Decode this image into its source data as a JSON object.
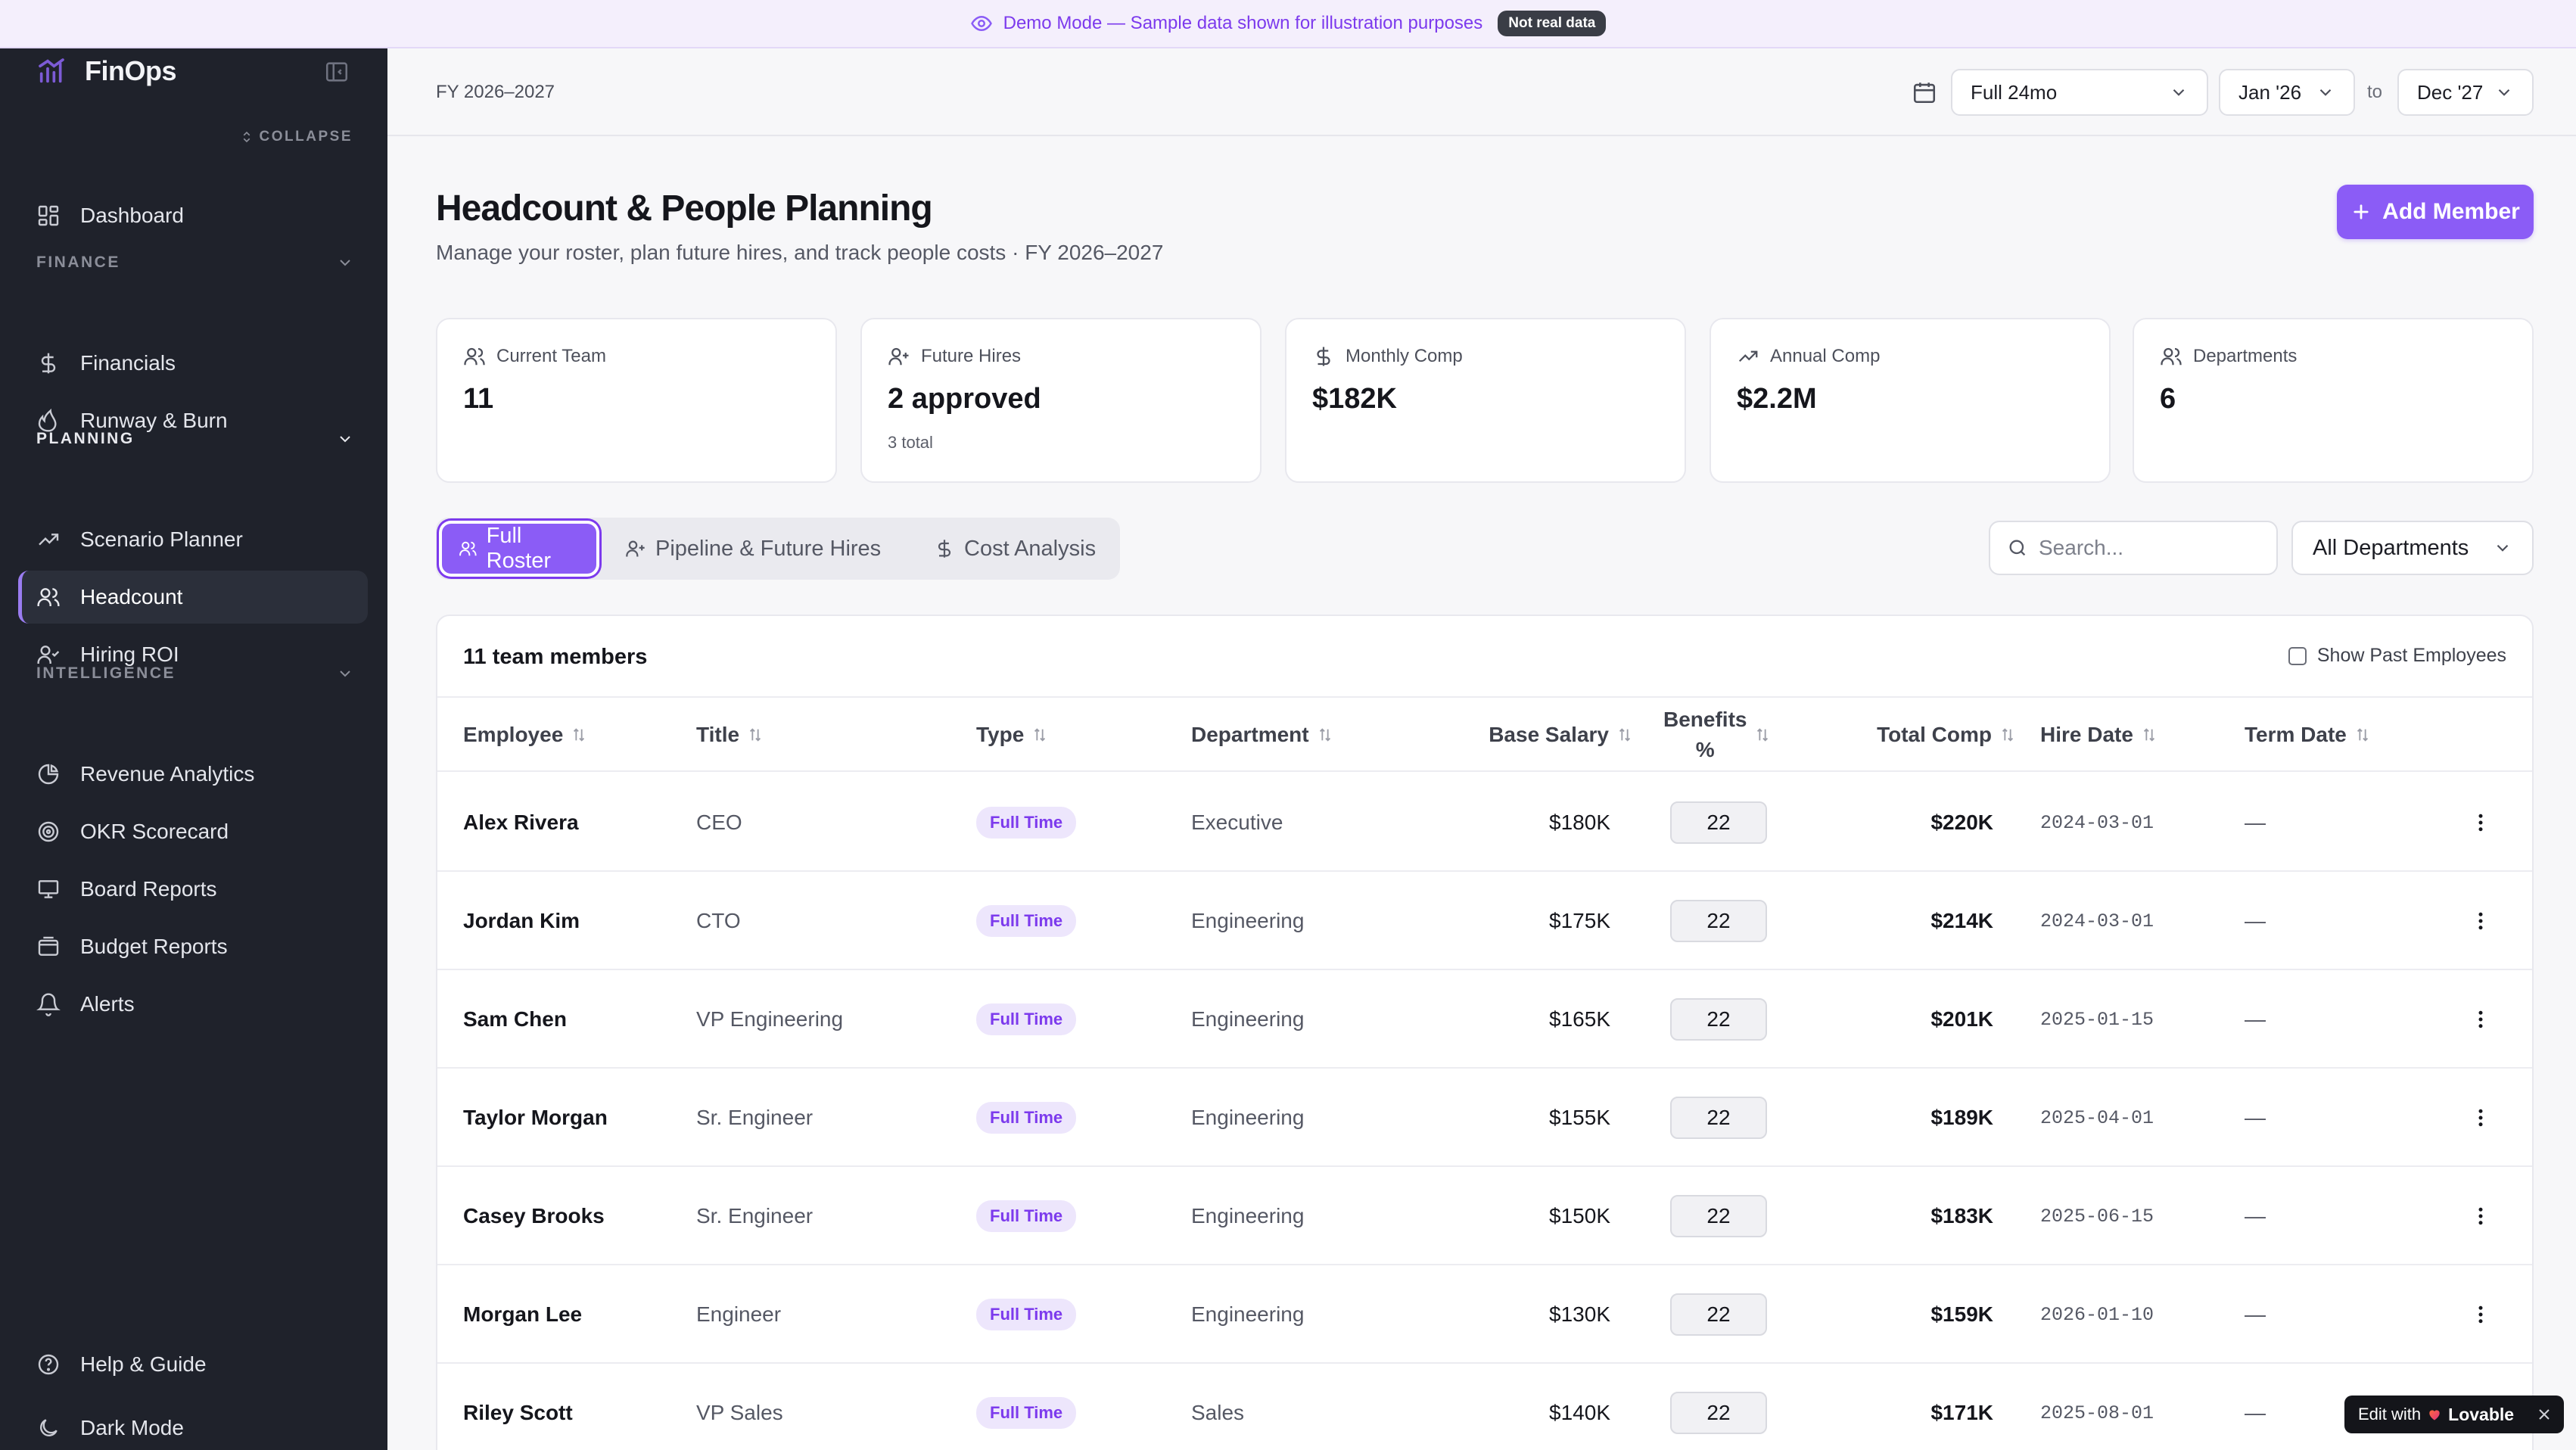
{
  "banner": {
    "text": "Demo Mode — Sample data shown for illustration purposes",
    "badge": "Not real data"
  },
  "sidebar": {
    "brand": "FinOps",
    "collapse_label": "COLLAPSE",
    "dashboard": "Dashboard",
    "sections": {
      "finance": "FINANCE",
      "planning": "PLANNING",
      "intelligence": "INTELLIGENCE"
    },
    "finance_items": [
      "Financials",
      "Runway & Burn"
    ],
    "planning_items": [
      "Scenario Planner",
      "Headcount",
      "Hiring ROI"
    ],
    "intelligence_items": [
      "Revenue Analytics",
      "OKR Scorecard",
      "Board Reports",
      "Budget Reports",
      "Alerts"
    ],
    "footer_items": [
      "Help & Guide",
      "Dark Mode"
    ],
    "active_item": "Headcount"
  },
  "topbar": {
    "fiscal_year": "FY 2026–2027",
    "range_preset": "Full 24mo",
    "start_month": "Jan '26",
    "to_label": "to",
    "end_month": "Dec '27"
  },
  "page": {
    "title": "Headcount & People Planning",
    "subtitle": "Manage your roster, plan future hires, and track people costs · FY 2026–2027",
    "add_button": "Add Member"
  },
  "stats": [
    {
      "label": "Current Team",
      "value": "11",
      "sub": "",
      "icon": "users-icon"
    },
    {
      "label": "Future Hires",
      "value": "2 approved",
      "sub": "3 total",
      "icon": "user-plus-icon"
    },
    {
      "label": "Monthly Comp",
      "value": "$182K",
      "sub": "",
      "icon": "dollar-icon"
    },
    {
      "label": "Annual Comp",
      "value": "$2.2M",
      "sub": "",
      "icon": "trending-up-icon"
    },
    {
      "label": "Departments",
      "value": "6",
      "sub": "",
      "icon": "users-icon"
    }
  ],
  "tabs": {
    "full_roster": "Full Roster",
    "pipeline": "Pipeline & Future Hires",
    "cost": "Cost Analysis",
    "active": "Full Roster"
  },
  "filters": {
    "search_placeholder": "Search...",
    "department": "All Departments"
  },
  "table": {
    "count_label": "11 team members",
    "past_employees_label": "Show Past Employees",
    "columns": {
      "employee": "Employee",
      "title": "Title",
      "type": "Type",
      "department": "Department",
      "base_salary": "Base Salary",
      "benefits_1": "Benefits",
      "benefits_2": "%",
      "total_comp": "Total Comp",
      "hire_date": "Hire Date",
      "term_date": "Term Date"
    },
    "rows": [
      {
        "name": "Alex Rivera",
        "title": "CEO",
        "type": "Full Time",
        "department": "Executive",
        "salary": "$180K",
        "benefits": "22",
        "total": "$220K",
        "hire": "2024-03-01",
        "term": "—"
      },
      {
        "name": "Jordan Kim",
        "title": "CTO",
        "type": "Full Time",
        "department": "Engineering",
        "salary": "$175K",
        "benefits": "22",
        "total": "$214K",
        "hire": "2024-03-01",
        "term": "—"
      },
      {
        "name": "Sam Chen",
        "title": "VP Engineering",
        "type": "Full Time",
        "department": "Engineering",
        "salary": "$165K",
        "benefits": "22",
        "total": "$201K",
        "hire": "2025-01-15",
        "term": "—"
      },
      {
        "name": "Taylor Morgan",
        "title": "Sr. Engineer",
        "type": "Full Time",
        "department": "Engineering",
        "salary": "$155K",
        "benefits": "22",
        "total": "$189K",
        "hire": "2025-04-01",
        "term": "—"
      },
      {
        "name": "Casey Brooks",
        "title": "Sr. Engineer",
        "type": "Full Time",
        "department": "Engineering",
        "salary": "$150K",
        "benefits": "22",
        "total": "$183K",
        "hire": "2025-06-15",
        "term": "—"
      },
      {
        "name": "Morgan Lee",
        "title": "Engineer",
        "type": "Full Time",
        "department": "Engineering",
        "salary": "$130K",
        "benefits": "22",
        "total": "$159K",
        "hire": "2026-01-10",
        "term": "—"
      },
      {
        "name": "Riley Scott",
        "title": "VP Sales",
        "type": "Full Time",
        "department": "Sales",
        "salary": "$140K",
        "benefits": "22",
        "total": "$171K",
        "hire": "2025-08-01",
        "term": "—"
      }
    ]
  },
  "lovable": {
    "prefix": "Edit with",
    "brand": "Lovable"
  },
  "colors": {
    "accent": "#8b5cf6",
    "sidebar_bg": "#1f222b",
    "badge_bg": "#ede6fc",
    "badge_text": "#7c3aed"
  }
}
